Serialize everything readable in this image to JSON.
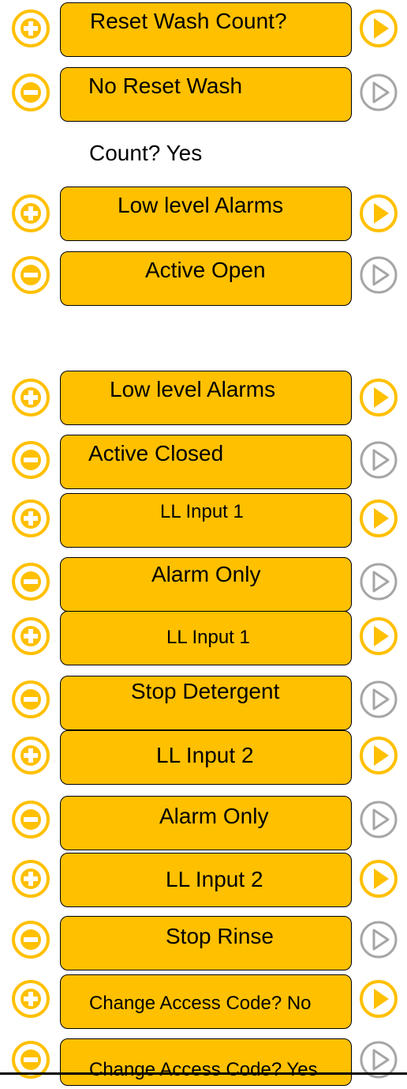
{
  "buttons": [
    {
      "label": "Reset Wash Count?"
    },
    {
      "label": "No Reset Wash"
    },
    {
      "label": "Low level Alarms"
    },
    {
      "label": "Active Open"
    },
    {
      "label": "Low level Alarms"
    },
    {
      "label": "Active Closed"
    },
    {
      "label": "LL Input 1"
    },
    {
      "label": "Alarm Only"
    },
    {
      "label": "LL Input 1"
    },
    {
      "label": "Stop Detergent"
    },
    {
      "label": "LL Input 2"
    },
    {
      "label": "Alarm Only"
    },
    {
      "label": "LL Input 2"
    },
    {
      "label": "Stop Rinse"
    },
    {
      "label": "Change Access Code? No"
    },
    {
      "label": "Change Access Code? Yes"
    }
  ],
  "continuation_text": "Count? Yes",
  "icons": {
    "plus": "plus-circle-icon",
    "minus": "minus-circle-icon",
    "play_active": "play-icon",
    "play_inactive": "play-outline-icon"
  },
  "colors": {
    "accent": "#ffc000",
    "inactive": "#a6a6a6"
  }
}
